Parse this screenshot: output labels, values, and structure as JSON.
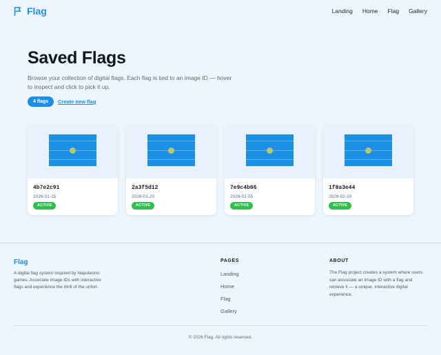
{
  "header": {
    "brand": "Flag",
    "nav": [
      "Landing",
      "Home",
      "Flag",
      "Gallery"
    ]
  },
  "hero": {
    "title": "Saved Flags",
    "description": "Browse your collection of digital flags. Each flag is tied to an image ID — hover to inspect and click to pick it up.",
    "count_badge": "4 flags",
    "create_link": "Create new flag"
  },
  "cards": [
    {
      "id": "4b7e2c91",
      "date": "2026-01-15",
      "status": "ACTIVE"
    },
    {
      "id": "2a3f5d12",
      "date": "2026-01-20",
      "status": "ACTIVE"
    },
    {
      "id": "7e9c4b66",
      "date": "2026-02-05",
      "status": "ACTIVE"
    },
    {
      "id": "1f8a3e44",
      "date": "2026-02-10",
      "status": "ACTIVE"
    }
  ],
  "footer": {
    "brand": "Flag",
    "description": "A digital flag system inspired by Napoleonic games. Associate image IDs with interactive flags and experience the thrill of the unfurl.",
    "pages_heading": "PAGES",
    "pages": [
      "Landing",
      "Home",
      "Flag",
      "Gallery"
    ],
    "about_heading": "ABOUT",
    "about_text": "The Flag project creates a system where users can associate an image ID with a flag and retrieve it — a unique, interactive digital experience.",
    "copyright": "© 2026 Flag. All rights reserved."
  },
  "colors": {
    "accent": "#1a8fe3",
    "status_active": "#2ec04a",
    "background": "#eef5fc"
  },
  "icons": {
    "brand": "flag-outline-icon"
  }
}
